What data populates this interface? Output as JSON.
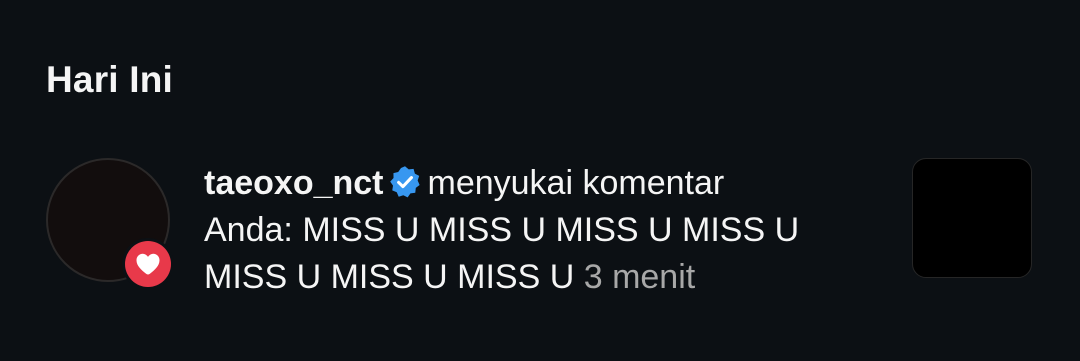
{
  "section": {
    "title": "Hari Ini"
  },
  "notification": {
    "username": "taeoxo_nct",
    "verified": true,
    "action": "menyukai komentar",
    "comment_prefix": "Anda:",
    "comment": "MISS U MISS U MISS U MISS U MISS U MISS U MISS U",
    "time": "3 menit",
    "badge_icon": "heart-icon",
    "verified_icon": "verified-badge-icon"
  },
  "colors": {
    "background": "#0c1014",
    "text": "#f5f5f5",
    "muted_text": "#a8a8a8",
    "verified": "#3797f0",
    "like_badge": "#e8394a"
  }
}
